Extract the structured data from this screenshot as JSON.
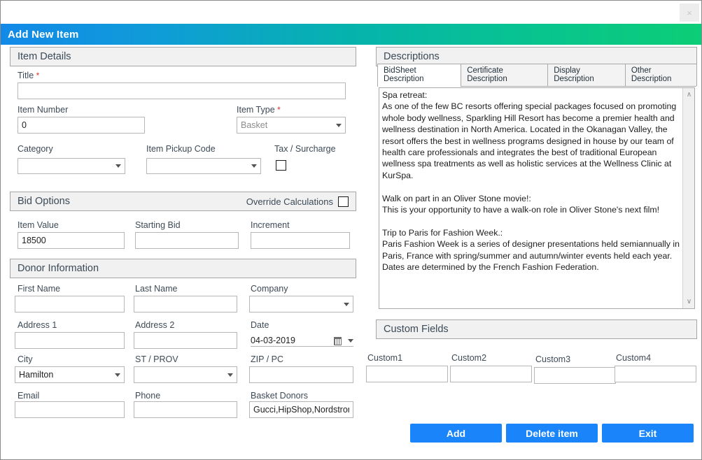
{
  "window": {
    "close_label": "×",
    "title": "Add New Item"
  },
  "sections": {
    "item_details": "Item Details",
    "bid_options": "Bid Options",
    "donor_information": "Donor Information",
    "descriptions": "Descriptions",
    "custom_fields": "Custom Fields"
  },
  "item_details": {
    "title_label": "Title",
    "title_required": "*",
    "title_value": "",
    "item_number_label": "Item Number",
    "item_number_value": "0",
    "item_type_label": "Item Type",
    "item_type_required": "*",
    "item_type_value": "Basket",
    "category_label": "Category",
    "category_value": "",
    "pickup_code_label": "Item Pickup Code",
    "pickup_code_value": "",
    "tax_surcharge_label": "Tax / Surcharge",
    "tax_surcharge_checked": false
  },
  "bid_options": {
    "override_label": "Override Calculations",
    "override_checked": false,
    "item_value_label": "Item Value",
    "item_value": "18500",
    "starting_bid_label": "Starting Bid",
    "starting_bid_value": "",
    "increment_label": "Increment",
    "increment_value": ""
  },
  "donor": {
    "first_name_label": "First Name",
    "first_name_value": "",
    "last_name_label": "Last Name",
    "last_name_value": "",
    "company_label": "Company",
    "company_value": "",
    "address1_label": "Address 1",
    "address1_value": "",
    "address2_label": "Address 2",
    "address2_value": "",
    "date_label": "Date",
    "date_value": "04-03-2019",
    "city_label": "City",
    "city_value": "Hamilton",
    "state_label": "ST / PROV",
    "state_value": "",
    "zip_label": "ZIP / PC",
    "zip_value": "",
    "email_label": "Email",
    "email_value": "",
    "phone_label": "Phone",
    "phone_value": "",
    "basket_donors_label": "Basket Donors",
    "basket_donors_value": "Gucci,HipShop,Nordstrom"
  },
  "descriptions": {
    "tabs": [
      {
        "label": "BidSheet Description",
        "active": true
      },
      {
        "label": "Certificate Description",
        "active": false
      },
      {
        "label": "Display Description",
        "active": false
      },
      {
        "label": "Other Description",
        "active": false
      }
    ],
    "body": "Spa retreat:\nAs one of the few BC resorts offering special packages focused on promoting whole body wellness, Sparkling Hill Resort has become a premier health and wellness destination in North America. Located in the Okanagan Valley, the resort offers the best in wellness programs designed in house by our team of health care professionals and integrates the best of traditional European wellness spa treatments as well as holistic services at the Wellness Clinic at KurSpa.\n\nWalk on part in an Oliver Stone movie!:\nThis is your opportunity to have a walk-on role in Oliver Stone's next film!\n\nTrip to Paris for Fashion Week.:\nParis Fashion Week is a series of designer presentations held semiannually in Paris, France with spring/summer and autumn/winter events held each year. Dates are determined by the French Fashion Federation.",
    "scroll_up": "∧",
    "scroll_down": "∨"
  },
  "custom_fields": [
    {
      "label": "Custom1",
      "value": ""
    },
    {
      "label": "Custom2",
      "value": ""
    },
    {
      "label": "Custom3",
      "value": ""
    },
    {
      "label": "Custom4",
      "value": ""
    }
  ],
  "actions": {
    "add": "Add",
    "delete": "Delete item",
    "exit": "Exit"
  },
  "colors": {
    "accent_blue": "#1a85fb",
    "title_gradient_start": "#1289e8",
    "title_gradient_end": "#0ccd77",
    "required_marker": "#e03030"
  }
}
